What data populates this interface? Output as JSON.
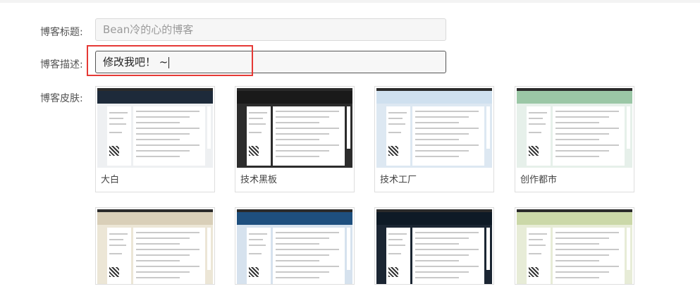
{
  "form": {
    "title_label": "博客标题:",
    "title_placeholder": "Bean冷的心的博客",
    "desc_label": "博客描述:",
    "desc_value": "修改我吧！ ~",
    "skin_label": "博客皮肤:"
  },
  "skins": [
    {
      "name": "大白",
      "banner": "#1d2a3a",
      "bg": "#eef0f2"
    },
    {
      "name": "技术黑板",
      "banner": "#1a1a1a",
      "bg": "#2c2c2c"
    },
    {
      "name": "技术工厂",
      "banner": "#cfe0ef",
      "bg": "#dde8f2"
    },
    {
      "name": "创作都市",
      "banner": "#9bc7a6",
      "bg": "#e6f0ea"
    },
    {
      "name": "",
      "banner": "#d9cfb8",
      "bg": "#ece6d6"
    },
    {
      "name": "",
      "banner": "#1e4f7e",
      "bg": "#d6e2ee"
    },
    {
      "name": "",
      "banner": "#0e1a26",
      "bg": "#1b2633"
    },
    {
      "name": "",
      "banner": "#cbd8a8",
      "bg": "#e7ecd7"
    }
  ],
  "colors": {
    "highlight": "#e53935"
  }
}
